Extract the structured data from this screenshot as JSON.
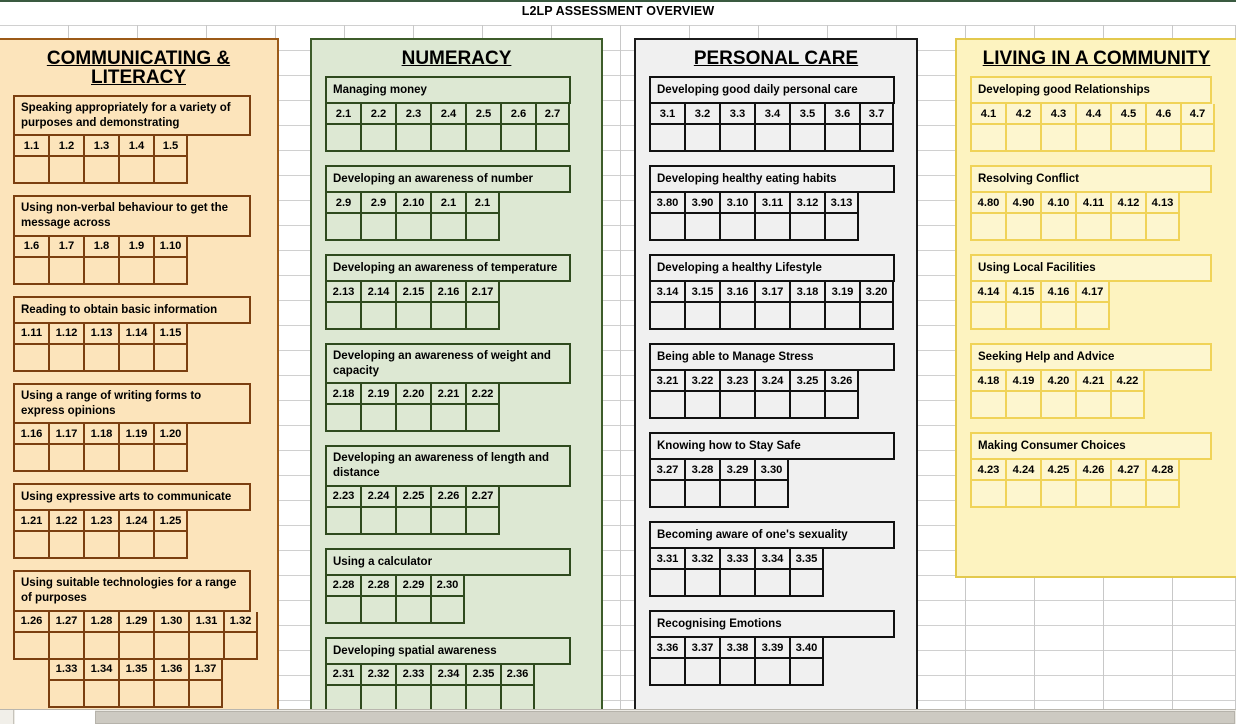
{
  "document": {
    "title": "L2LP ASSESSMENT OVERVIEW"
  },
  "colors": {
    "literacy_fill": "#fce4bb",
    "literacy_border": "#7b3f10",
    "numeracy_fill": "#dde8d3",
    "numeracy_border": "#2f4a1e",
    "personal_fill": "#f0f0f0",
    "personal_border": "#111111",
    "community_fill": "#fdf6cf",
    "community_border": "#f0d358"
  },
  "panels": [
    {
      "id": "literacy",
      "title": "COMMUNICATING & LITERACY",
      "groups": [
        {
          "heading": "Speaking appropriately for a variety of purposes and demonstrating",
          "lines": 2,
          "codes": [
            "1.1",
            "1.2",
            "1.3",
            "1.4",
            "1.5"
          ],
          "indent": 0
        },
        {
          "heading": "Using non-verbal behaviour to get the message across",
          "lines": 2,
          "codes": [
            "1.6",
            "1.7",
            "1.8",
            "1.9",
            "1.10"
          ],
          "indent": 0
        },
        {
          "heading": "Reading to obtain basic information",
          "lines": 1,
          "codes": [
            "1.11",
            "1.12",
            "1.13",
            "1.14",
            "1.15"
          ],
          "indent": 0
        },
        {
          "heading": "Using a range of writing forms to express opinions",
          "lines": 2,
          "codes": [
            "1.16",
            "1.17",
            "1.18",
            "1.19",
            "1.20"
          ],
          "indent": 0
        },
        {
          "heading": "Using expressive arts to communicate",
          "lines": 1,
          "codes": [
            "1.21",
            "1.22",
            "1.23",
            "1.24",
            "1.25"
          ],
          "indent": 0
        },
        {
          "heading": "Using suitable technologies for a range of purposes",
          "lines": 2,
          "codes": [
            "1.26",
            "1.27",
            "1.28",
            "1.29",
            "1.30",
            "1.31",
            "1.32"
          ],
          "indent": 0
        },
        {
          "heading": "",
          "lines": 0,
          "codes": [
            "1.33",
            "1.34",
            "1.35",
            "1.36",
            "1.37"
          ],
          "indent": 1
        }
      ]
    },
    {
      "id": "numeracy",
      "title": "NUMERACY",
      "groups": [
        {
          "heading": "Managing money",
          "lines": 1,
          "codes": [
            "2.1",
            "2.2",
            "2.3",
            "2.4",
            "2.5",
            "2.6",
            "2.7"
          ],
          "indent": 0
        },
        {
          "heading": "Developing an awareness of number",
          "lines": 1,
          "codes": [
            "2.9",
            "2.9",
            "2.10",
            "2.1",
            "2.1"
          ],
          "indent": 0
        },
        {
          "heading": "Developing an awareness of temperature",
          "lines": 1,
          "codes": [
            "2.13",
            "2.14",
            "2.15",
            "2.16",
            "2.17"
          ],
          "indent": 0
        },
        {
          "heading": "Developing an awareness of weight and capacity",
          "lines": 2,
          "codes": [
            "2.18",
            "2.19",
            "2.20",
            "2.21",
            "2.22"
          ],
          "indent": 0
        },
        {
          "heading": "Developing an awareness of length and distance",
          "lines": 2,
          "codes": [
            "2.23",
            "2.24",
            "2.25",
            "2.26",
            "2.27"
          ],
          "indent": 0
        },
        {
          "heading": "Using a calculator",
          "lines": 1,
          "codes": [
            "2.28",
            "2.28",
            "2.29",
            "2.30"
          ],
          "indent": 0
        },
        {
          "heading": "Developing spatial awareness",
          "lines": 1,
          "codes": [
            "2.31",
            "2.32",
            "2.33",
            "2.34",
            "2.35",
            "2.36"
          ],
          "indent": 0
        }
      ]
    },
    {
      "id": "personal",
      "title": "PERSONAL CARE",
      "groups": [
        {
          "heading": "Developing good daily personal care",
          "lines": 1,
          "codes": [
            "3.1",
            "3.2",
            "3.3",
            "3.4",
            "3.5",
            "3.6",
            "3.7"
          ],
          "indent": 0
        },
        {
          "heading": "Developing healthy eating habits",
          "lines": 1,
          "codes": [
            "3.80",
            "3.90",
            "3.10",
            "3.11",
            "3.12",
            "3.13"
          ],
          "indent": 0
        },
        {
          "heading": "Developing a healthy Lifestyle",
          "lines": 1,
          "codes": [
            "3.14",
            "3.15",
            "3.16",
            "3.17",
            "3.18",
            "3.19",
            "3.20"
          ],
          "indent": 0
        },
        {
          "heading": "Being able to Manage Stress",
          "lines": 1,
          "codes": [
            "3.21",
            "3.22",
            "3.23",
            "3.24",
            "3.25",
            "3.26"
          ],
          "indent": 0
        },
        {
          "heading": "Knowing how to Stay Safe",
          "lines": 1,
          "codes": [
            "3.27",
            "3.28",
            "3.29",
            "3.30"
          ],
          "indent": 0
        },
        {
          "heading": "Becoming aware of one's sexuality",
          "lines": 1,
          "codes": [
            "3.31",
            "3.32",
            "3.33",
            "3.34",
            "3.35"
          ],
          "indent": 0
        },
        {
          "heading": "Recognising Emotions",
          "lines": 1,
          "codes": [
            "3.36",
            "3.37",
            "3.38",
            "3.39",
            "3.40"
          ],
          "indent": 0
        }
      ]
    },
    {
      "id": "community",
      "title": "LIVING IN A COMMUNITY",
      "groups": [
        {
          "heading": "Developing good Relationships",
          "lines": 1,
          "codes": [
            "4.1",
            "4.2",
            "4.3",
            "4.4",
            "4.5",
            "4.6",
            "4.7"
          ],
          "indent": 0
        },
        {
          "heading": "Resolving Conflict",
          "lines": 1,
          "codes": [
            "4.80",
            "4.90",
            "4.10",
            "4.11",
            "4.12",
            "4.13"
          ],
          "indent": 0
        },
        {
          "heading": "Using Local Facilities",
          "lines": 1,
          "codes": [
            "4.14",
            "4.15",
            "4.16",
            "4.17"
          ],
          "indent": 0
        },
        {
          "heading": "Seeking Help and Advice",
          "lines": 1,
          "codes": [
            "4.18",
            "4.19",
            "4.20",
            "4.21",
            "4.22"
          ],
          "indent": 0
        },
        {
          "heading": "Making Consumer Choices",
          "lines": 1,
          "codes": [
            "4.23",
            "4.24",
            "4.25",
            "4.26",
            "4.27",
            "4.28"
          ],
          "indent": 0
        }
      ]
    }
  ]
}
